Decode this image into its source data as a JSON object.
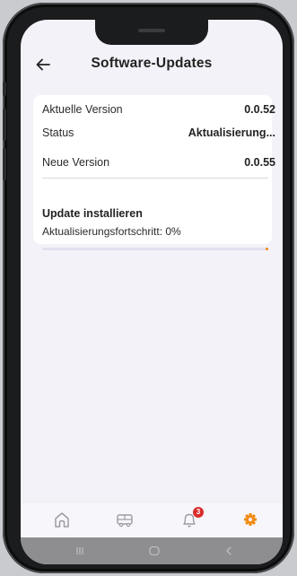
{
  "header": {
    "title": "Software-Updates"
  },
  "info": {
    "current_version_label": "Aktuelle Version",
    "current_version_value": "0.0.52",
    "status_label": "Status",
    "status_value": "Aktualisierung...",
    "new_version_label": "Neue Version",
    "new_version_value": "0.0.55"
  },
  "update": {
    "title": "Update installieren",
    "progress_text": "Aktualisierungsfortschritt: 0%",
    "progress_fraction": 0
  },
  "tabbar": {
    "items": [
      {
        "icon": "home-icon",
        "active": false
      },
      {
        "icon": "vehicle-icon",
        "active": false
      },
      {
        "icon": "bell-icon",
        "active": false,
        "badge": "3"
      },
      {
        "icon": "gear-icon",
        "active": true
      }
    ],
    "active_color": "#f08a12",
    "inactive_color": "#9b9ba3",
    "badge_color": "#d82c2c"
  },
  "system_nav": {
    "icons": [
      "recents-icon",
      "home-circle-icon",
      "back-chevron-icon"
    ]
  }
}
